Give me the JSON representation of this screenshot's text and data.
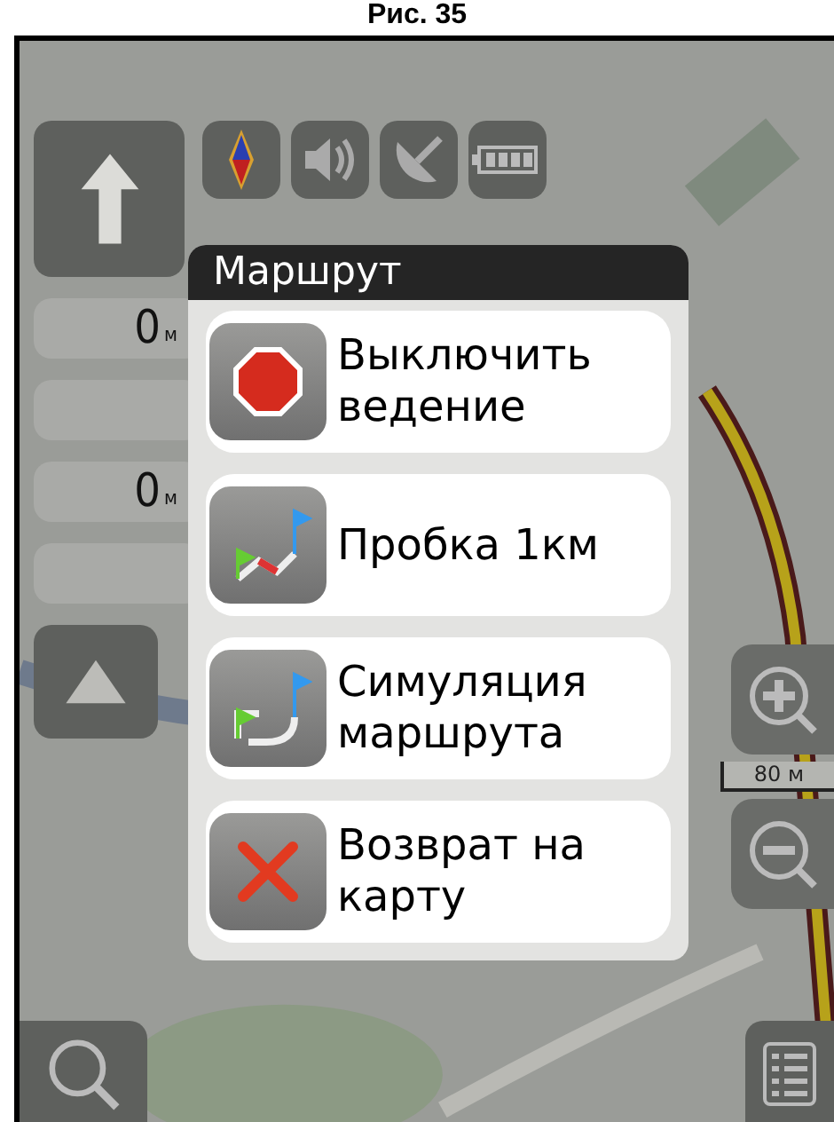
{
  "caption": "Рис. 35",
  "status_icons": [
    {
      "kind": "compass"
    },
    {
      "kind": "sound"
    },
    {
      "kind": "satellite"
    },
    {
      "kind": "battery"
    }
  ],
  "distance_fields": [
    {
      "value": "0",
      "unit": "м"
    },
    {
      "value": "0",
      "unit": "м"
    }
  ],
  "scale": "80 м",
  "menu": {
    "title": "Маршрут",
    "items": [
      {
        "kind": "stop",
        "label": "Выключить ведение"
      },
      {
        "kind": "jam",
        "label": "Пробка 1км"
      },
      {
        "kind": "simulate",
        "label": "Симуляция маршрута"
      },
      {
        "kind": "close",
        "label": "Возврат на карту"
      }
    ]
  }
}
